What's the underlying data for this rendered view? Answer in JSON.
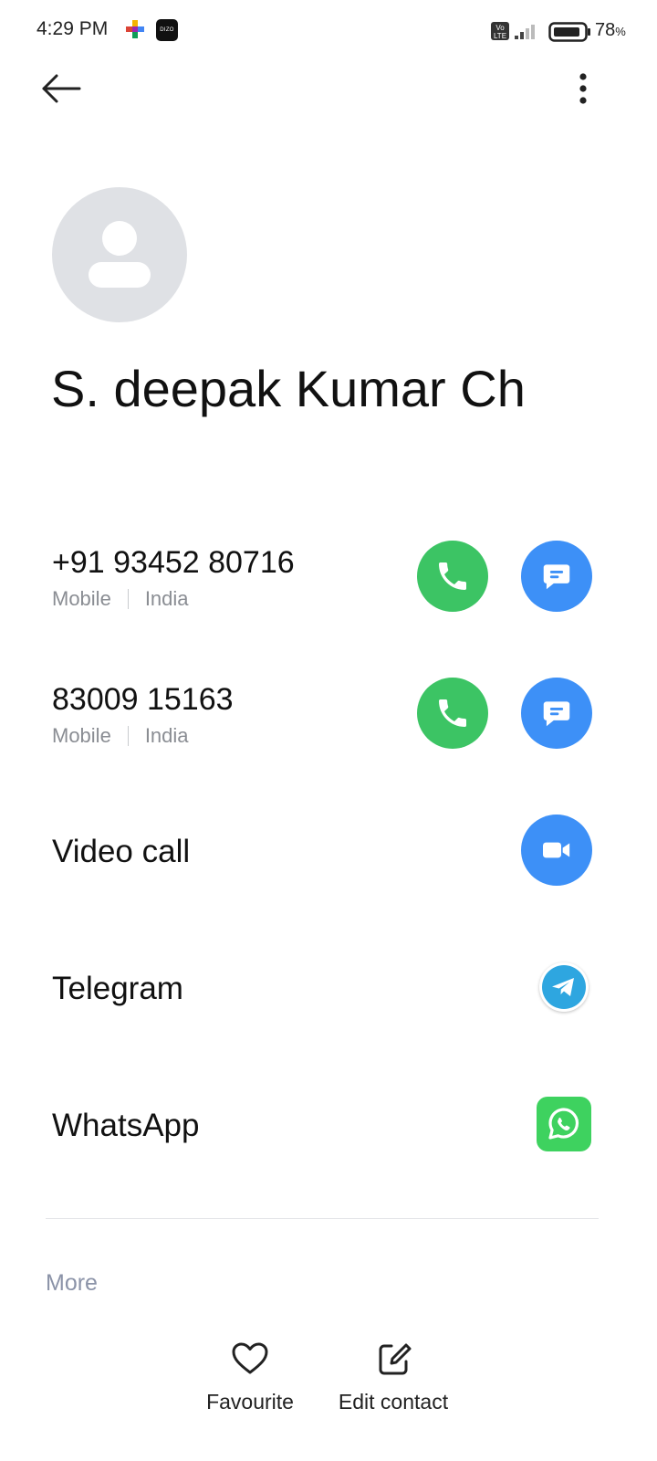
{
  "status_bar": {
    "time": "4:29 PM",
    "notification_badge": "DIZO",
    "battery_percent": "78",
    "battery_unit": "%",
    "icons": [
      "games-icon",
      "dizo-app-icon",
      "volte-icon",
      "signal-icon",
      "battery-icon"
    ]
  },
  "contact": {
    "name": "S. deepak Kumar Ch"
  },
  "phones": [
    {
      "number": "+91 93452 80716",
      "type": "Mobile",
      "region": "India"
    },
    {
      "number": "83009 15163",
      "type": "Mobile",
      "region": "India"
    }
  ],
  "actions": {
    "video_call": "Video call",
    "telegram": "Telegram",
    "whatsapp": "WhatsApp",
    "more": "More",
    "favourite": "Favourite",
    "edit_contact": "Edit contact"
  },
  "colors": {
    "call_green": "#3cc464",
    "message_blue": "#3d90f7",
    "telegram_blue": "#2ea6e0",
    "whatsapp_green": "#3ed25f",
    "avatar_bg": "#dfe1e5"
  }
}
